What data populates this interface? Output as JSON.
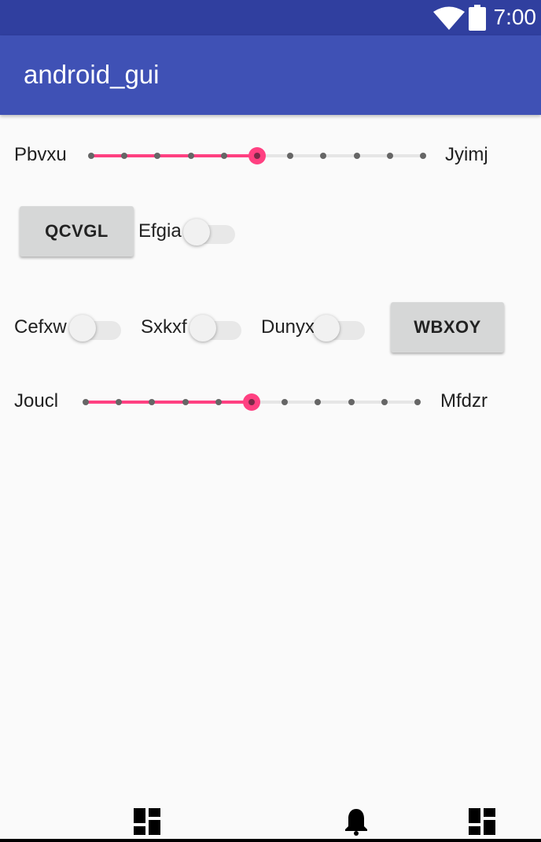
{
  "status_bar": {
    "time": "7:00",
    "color": "#303f9f",
    "icons": [
      "wifi-icon",
      "battery-icon"
    ]
  },
  "app_bar": {
    "title": "android_gui",
    "color": "#3f51b5"
  },
  "accent_color": "#ff4081",
  "slider1": {
    "left_label": "Pbvxu",
    "right_label": "Jyimj",
    "steps": 10,
    "value": 5
  },
  "row2": {
    "button_label": "QCVGL",
    "switch_label": "Efgia",
    "switch_checked": false
  },
  "row3": {
    "switches": [
      {
        "label": "Cefxw",
        "checked": false
      },
      {
        "label": "Sxkxf",
        "checked": false
      },
      {
        "label": "Dunyx",
        "checked": false
      }
    ],
    "button_label": "WBXOY"
  },
  "slider2": {
    "left_label": "Joucl",
    "right_label": "Mfdzr",
    "steps": 10,
    "value": 5
  },
  "bottom_nav": {
    "icons": [
      "dashboard-icon",
      "bell-icon",
      "dashboard-icon"
    ]
  }
}
